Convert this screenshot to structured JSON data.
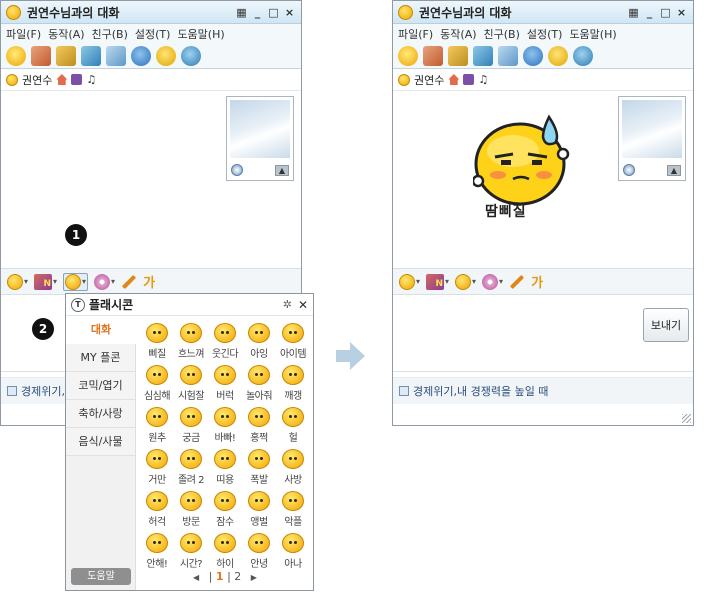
{
  "window": {
    "title": "권연수님과의 대화",
    "min": "_",
    "max": "□",
    "close": "×"
  },
  "menu": [
    "파일(F)",
    "동작(A)",
    "친구(B)",
    "설정(T)",
    "도움말(H)"
  ],
  "contact": {
    "name": "권연수",
    "note_glyph": "♫"
  },
  "toolbar2": {
    "pen_glyph": "✎",
    "text_glyph": "가"
  },
  "send_label": "보내기",
  "ad_text": "경제위기,내 경쟁력을 높일 때",
  "badges": {
    "one": "1",
    "two": "2"
  },
  "popup": {
    "title": "플래시콘",
    "logo": "T",
    "gear": "✲",
    "close": "✕",
    "categories": [
      "대화",
      "MY 플콘",
      "코믹/엽기",
      "축하/사랑",
      "음식/사물"
    ],
    "help": "도움말",
    "emoticons": [
      "삐질",
      "흐느껴",
      "웃긴다",
      "아잉",
      "아이템",
      "심심해",
      "시험잘",
      "버럭",
      "놀아줘",
      "깨갱",
      "원추",
      "궁금",
      "바빠!",
      "홍쩍",
      "헐",
      "거만",
      "졸려 2",
      "띠용",
      "폭발",
      "사방",
      "허걱",
      "방문",
      "잠수",
      "앵벌",
      "악플",
      "안해!",
      "시간?",
      "하이",
      "안녕",
      "아나"
    ],
    "pager": {
      "page1": "1",
      "page2": "2",
      "sep": "|",
      "prev": "◀",
      "next": "▶"
    }
  },
  "big_emoticon": {
    "label": "땀삐질"
  },
  "colors": {
    "accent": "#e2741c",
    "title_bg": "#cfe6f4",
    "arrow": "#b9d0e2"
  }
}
